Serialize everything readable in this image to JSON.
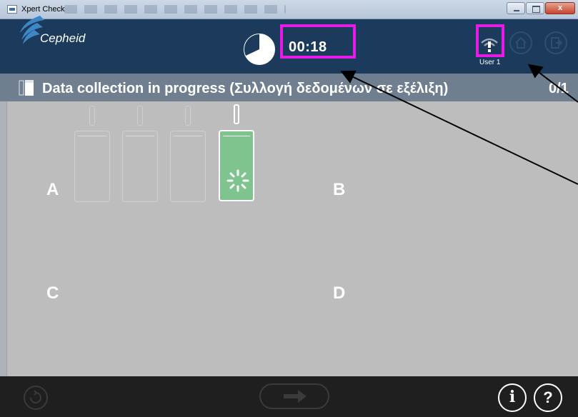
{
  "window": {
    "title": "Xpert Check",
    "close_label": "x"
  },
  "header": {
    "logo_text": "Cepheid",
    "timer": "00:18",
    "timer_progress": 0.68,
    "user": "User 1",
    "status_icon": "signal-alert-icon"
  },
  "status_strip": {
    "message": "Data collection in progress (Συλλογή δεδομένων σε εξέλιξη)",
    "count": "0/1"
  },
  "quadrants": {
    "a": "A",
    "b": "B",
    "c": "C",
    "d": "D"
  },
  "modules": [
    {
      "state": "idle"
    },
    {
      "state": "idle"
    },
    {
      "state": "idle"
    },
    {
      "state": "active"
    }
  ],
  "footer": {
    "info_label": "i",
    "help_label": "?"
  },
  "colors": {
    "header_bg": "#1c3a5c",
    "strip_bg": "#6f7f90",
    "content_bg": "#bdbdbd",
    "active_module": "#7fc48f",
    "highlight": "#e61be6",
    "footer_bg": "#1f1f1f"
  }
}
